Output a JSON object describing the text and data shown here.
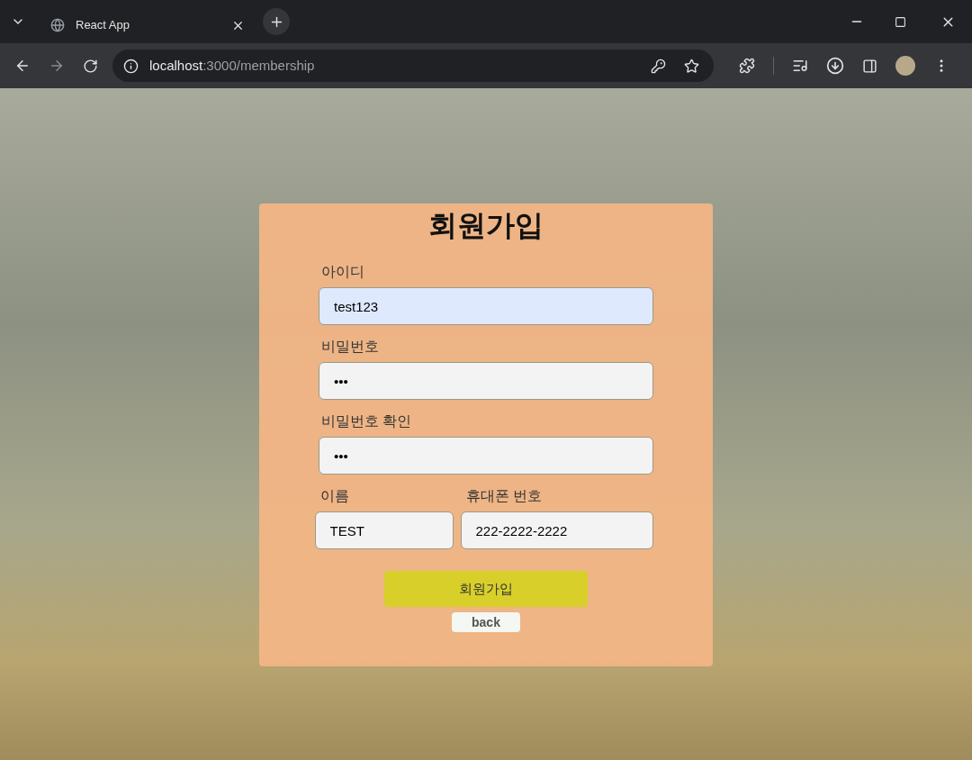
{
  "browser": {
    "tab": {
      "title": "React App",
      "selected": true
    },
    "address": {
      "host": "localhost",
      "path": ":3000/membership"
    }
  },
  "form": {
    "title": "회원가입",
    "fields": [
      {
        "label": "아이디",
        "value": "test123",
        "autofilled": true
      },
      {
        "label": "비밀번호",
        "value": "•••",
        "autofilled": false
      },
      {
        "label": "비밀번호 확인",
        "value": "•••",
        "autofilled": false
      }
    ],
    "pair": [
      {
        "label": "이름",
        "value": "TEST",
        "autofilled": false
      },
      {
        "label": "휴대폰 번호",
        "value": "222-2222-2222",
        "autofilled": false
      }
    ],
    "submit": "회원가입",
    "back": "back"
  }
}
